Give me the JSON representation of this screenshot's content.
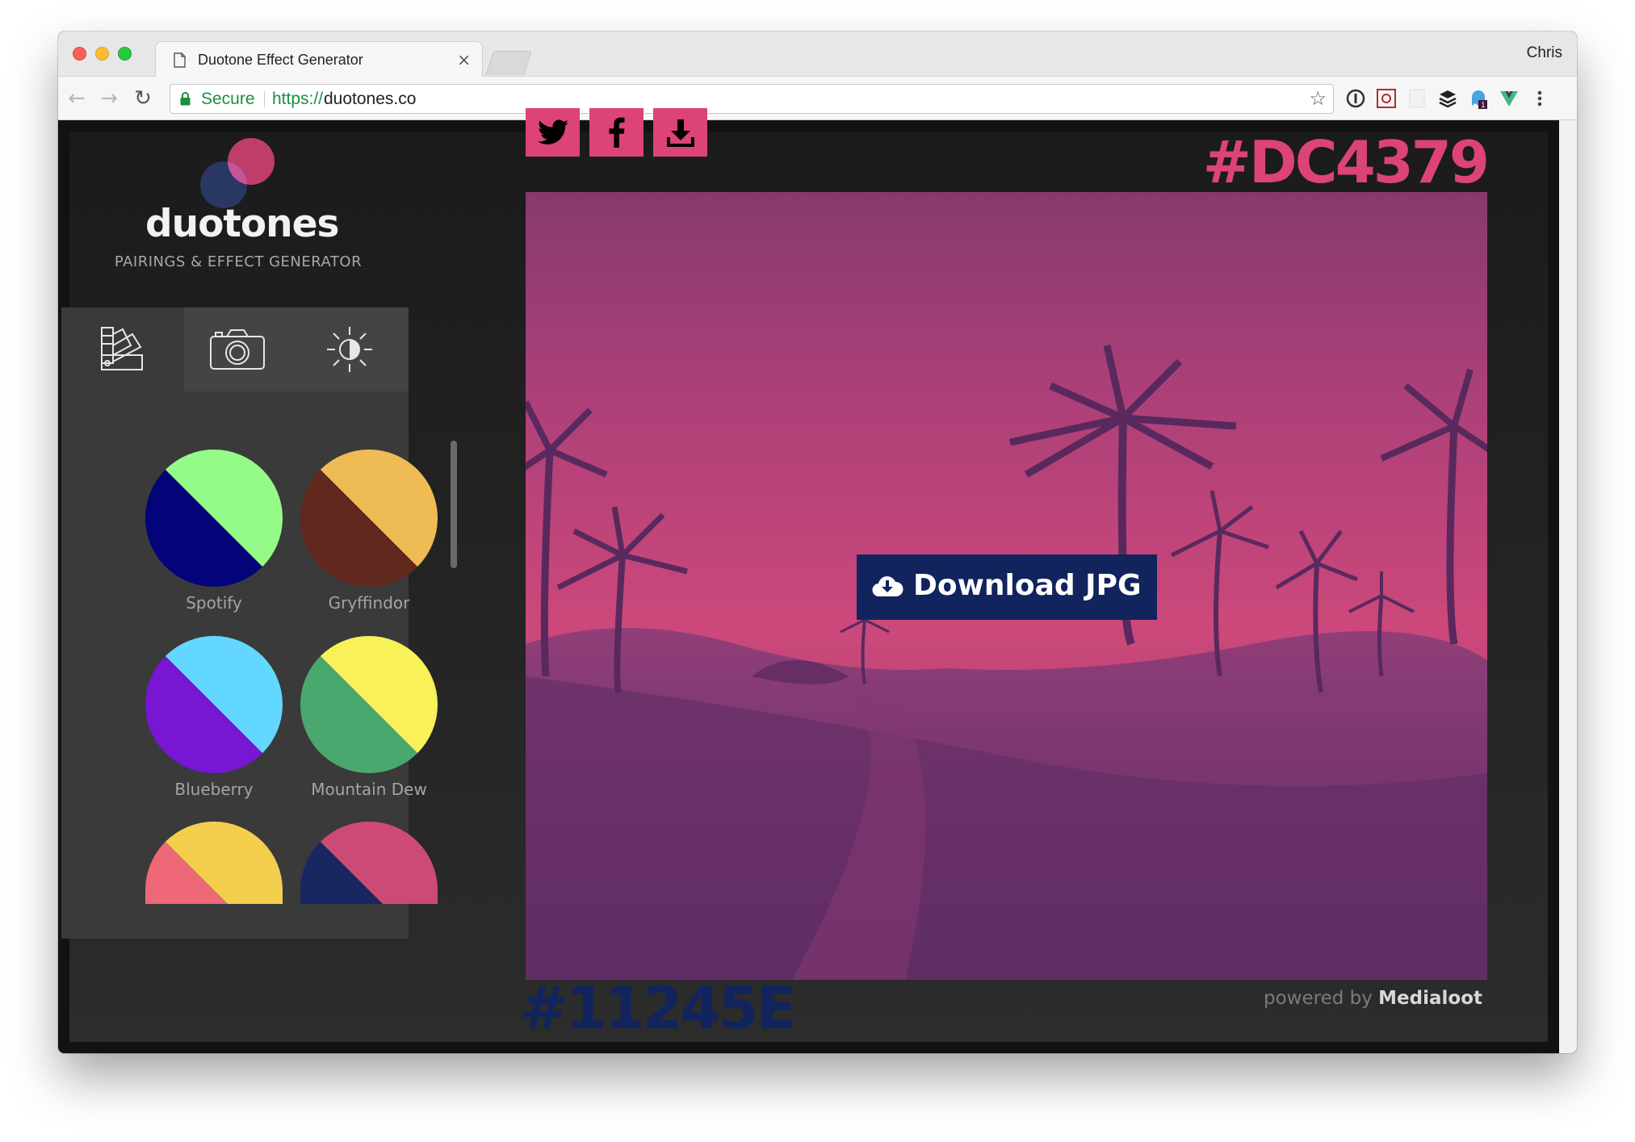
{
  "browser": {
    "tab_title": "Duotone Effect Generator",
    "profile": "Chris",
    "secure_label": "Secure",
    "url_scheme": "https://",
    "url_host": "duotones.co"
  },
  "sidebar": {
    "brand": "duotones",
    "tagline": "PAIRINGS & EFFECT GENERATOR",
    "tabs": [
      {
        "icon": "palette-swatch-icon"
      },
      {
        "icon": "camera-icon"
      },
      {
        "icon": "brightness-icon"
      }
    ],
    "swatches": [
      {
        "label": "Spotify",
        "color_a": "#94fc86",
        "color_b": "#03037a"
      },
      {
        "label": "Gryffindor",
        "color_a": "#efbb55",
        "color_b": "#61291d"
      },
      {
        "label": "Blueberry",
        "color_a": "#63d7ff",
        "color_b": "#7816d4"
      },
      {
        "label": "Mountain Dew",
        "color_a": "#f8f157",
        "color_b": "#4aa76e"
      },
      {
        "label": "",
        "color_a": "#f4ce4d",
        "color_b": "#ef6877"
      },
      {
        "label": "",
        "color_a": "#ce4a76",
        "color_b": "#18275f"
      }
    ]
  },
  "main": {
    "share_buttons": [
      {
        "icon": "twitter-icon"
      },
      {
        "icon": "facebook-icon"
      },
      {
        "icon": "download-icon"
      }
    ],
    "highlight_hex": "#DC4379",
    "shadow_hex": "#11245E",
    "download_label": "Download JPG",
    "powered_prefix": "powered by",
    "powered_brand": "Medialoot"
  },
  "colors": {
    "highlight": "#dc4379",
    "shadow": "#11245e"
  }
}
